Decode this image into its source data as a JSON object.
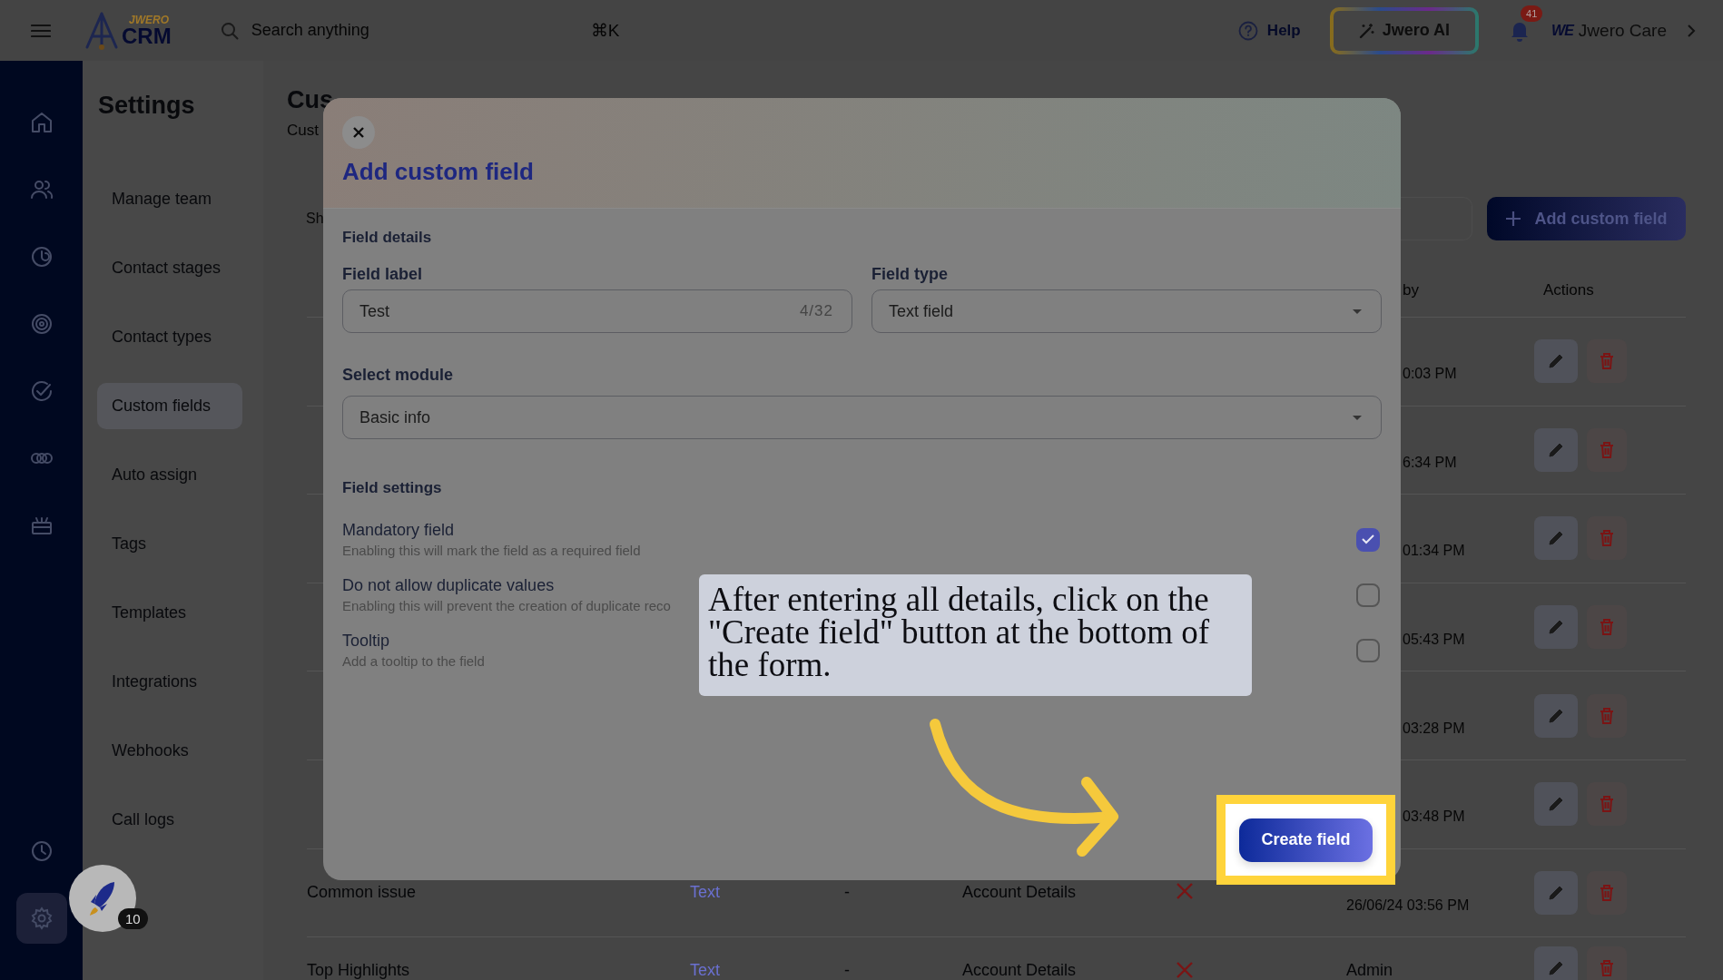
{
  "top_bar": {
    "logo_small": "JWERO",
    "logo": "CRM",
    "search": {
      "placeholder": "Search anything",
      "shortcut": "⌘K"
    },
    "help": "Help",
    "ai_button": "Jwero AI",
    "notifications": "41",
    "account_logo": "WE",
    "account": "Jwero Care"
  },
  "rail": {
    "items": [
      {
        "selected": false
      },
      {
        "selected": false
      },
      {
        "selected": false
      },
      {
        "selected": false
      },
      {
        "selected": false
      },
      {
        "selected": false
      },
      {
        "selected": false
      }
    ],
    "bottom_items": [
      {
        "selected": false
      },
      {
        "selected": true
      }
    ]
  },
  "launcher": {
    "badge": "10"
  },
  "settings": {
    "title": "Settings",
    "items": [
      {
        "label": "Manage team",
        "selected": false
      },
      {
        "label": "Contact stages",
        "selected": false
      },
      {
        "label": "Contact types",
        "selected": false
      },
      {
        "label": "Custom fields",
        "selected": true
      },
      {
        "label": "Auto assign",
        "selected": false
      },
      {
        "label": "Tags",
        "selected": false
      },
      {
        "label": "Templates",
        "selected": false
      },
      {
        "label": "Integrations",
        "selected": false
      },
      {
        "label": "Webhooks",
        "selected": false
      },
      {
        "label": "Call logs",
        "selected": false
      }
    ]
  },
  "page": {
    "title": "Cus",
    "subtitle": "Cust",
    "filter": "Sh",
    "add_button": "Add custom field"
  },
  "table": {
    "columns": [
      {
        "label": "by"
      },
      {
        "label": "Actions"
      }
    ],
    "rows": [
      {
        "created": "0:03 PM"
      },
      {
        "created": "6:34 PM"
      },
      {
        "created": "01:34 PM"
      },
      {
        "created": "05:43 PM"
      },
      {
        "created": "03:28 PM"
      },
      {
        "created": "03:48 PM"
      },
      {
        "name": "Common issue",
        "type": "Text",
        "default": "-",
        "module": "Account Details",
        "checked": false,
        "created": "26/06/24 03:56 PM"
      },
      {
        "name": "Top Highlights",
        "type": "Text",
        "default": "-",
        "module": "Account Details",
        "checked": false,
        "created": "Admin"
      }
    ]
  },
  "modal": {
    "title": "Add custom field",
    "details_heading": "Field details",
    "field_label": {
      "label": "Field label",
      "value": "Test",
      "counter": "4/32"
    },
    "field_type": {
      "label": "Field type",
      "value": "Text field"
    },
    "module": {
      "label": "Select module",
      "value": "Basic info"
    },
    "settings_heading": "Field settings",
    "settings": [
      {
        "title": "Mandatory field",
        "description": "Enabling this will mark the field as a required field",
        "checked": true
      },
      {
        "title": "Do not allow duplicate values",
        "description": "Enabling this will prevent the creation of duplicate reco",
        "checked": false
      },
      {
        "title": "Tooltip",
        "description": "Add a tooltip to the field",
        "checked": false
      }
    ],
    "create_button": "Create field"
  },
  "callout": {
    "text": "After entering all details, click on the \"Create field\" button at the bottom of the form."
  }
}
